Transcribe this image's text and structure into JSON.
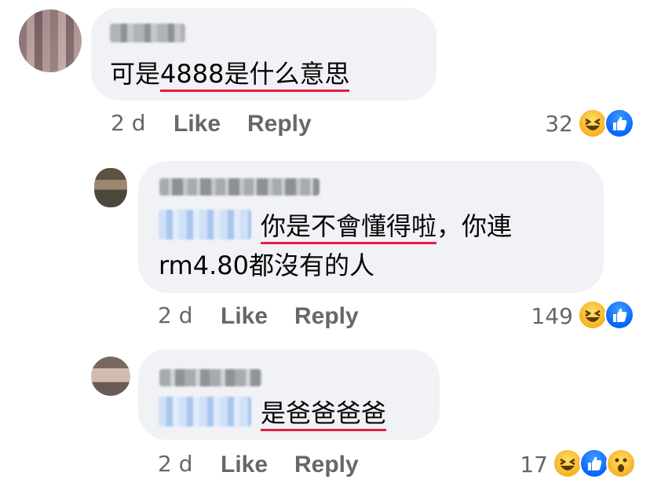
{
  "comments": [
    {
      "text_plain": "可是",
      "text_underlined": "4888是什么意思",
      "time": "2 d",
      "like_label": "Like",
      "reply_label": "Reply",
      "reaction_count": "32",
      "reactions": [
        "haha-emoji-icon",
        "like-emoji-icon"
      ]
    },
    {
      "text_underlined": "你是不會懂得啦",
      "text_line1_rest": "，你連",
      "text_line2": "rm4.80都沒有的人",
      "time": "2 d",
      "like_label": "Like",
      "reply_label": "Reply",
      "reaction_count": "149",
      "reactions": [
        "haha-emoji-icon",
        "like-emoji-icon"
      ]
    },
    {
      "text_underlined": "是爸爸爸爸",
      "time": "2 d",
      "like_label": "Like",
      "reply_label": "Reply",
      "reaction_count": "17",
      "reactions": [
        "haha-emoji-icon",
        "like-emoji-icon",
        "wow-emoji-icon"
      ]
    }
  ],
  "colors": {
    "bubble": "#f0f2f5",
    "underline": "#e41e3f",
    "meta_text": "#65676b",
    "like_blue": "#0866ff"
  }
}
